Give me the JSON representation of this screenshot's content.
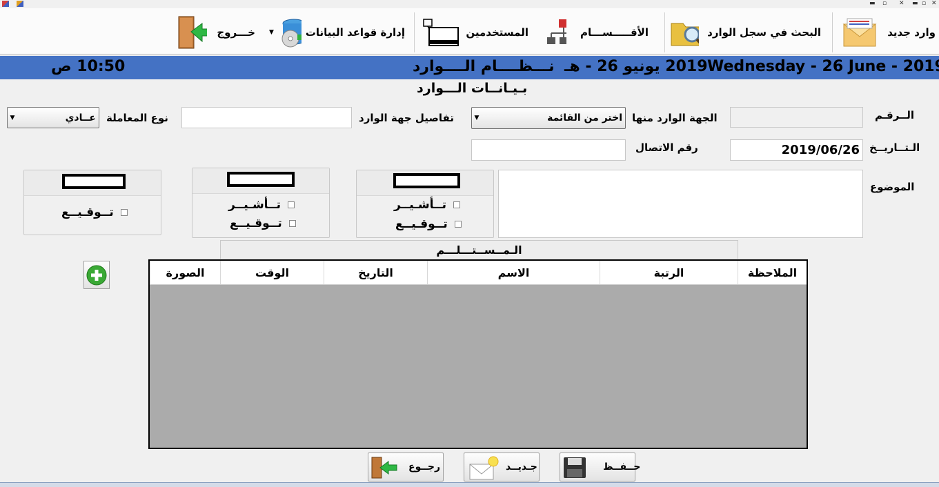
{
  "ribbon": {
    "new_incoming": "وارد جديد",
    "search_log": "البحث في سجل الوارد",
    "departments": "الأقـــــســـام",
    "users": "المستخدمين",
    "db_management": "إدارة قواعد البيانات",
    "exit": "خـــروج"
  },
  "header": {
    "date_gregorian": "Wednesday - 26  June - 2019",
    "date_hijri": "2019  يونيو  26 - هـ",
    "system_title": "نـــظــــام الــــوارد",
    "clock": "10:50 ص"
  },
  "form": {
    "section_title": "بـيـانــات الـــوارد",
    "number_label": "الــرقـم",
    "number_value": "",
    "source_label": "الجهة الوارد منها",
    "source_selected": "اختر من القائمة",
    "source_details_label": "تفاصيل جهة الوارد",
    "source_details_value": "",
    "transaction_type_label": "نوع المعاملة",
    "transaction_type_selected": "عــادي",
    "date_label": "الـتــاريــخ",
    "date_value": "2019/06/26",
    "contact_label": "رقم الاتصال",
    "contact_value": "",
    "subject_label": "الموضوع",
    "subject_value": ""
  },
  "approvals": {
    "panel1_annotate": "تــأشـيــر",
    "panel1_sign": "تــوقـيــع",
    "panel2_annotate": "تــأشـيــر",
    "panel2_sign": "تــوقـيــع",
    "panel3_sign": "تــوقـيــع"
  },
  "recipients": {
    "title": "الـمــســتـــلـــم",
    "columns": [
      "الملاحظة",
      "الرتبة",
      "الاسم",
      "التاريخ",
      "الوقت",
      "الصورة"
    ]
  },
  "buttons": {
    "save": "حــفــظ",
    "new": "جـديــد",
    "back": "رجــوع"
  },
  "colors": {
    "header_bar": "#4472c4",
    "grid_body": "#ababab",
    "add_button": "#3aa935",
    "exit_arrow": "#2fb845"
  }
}
